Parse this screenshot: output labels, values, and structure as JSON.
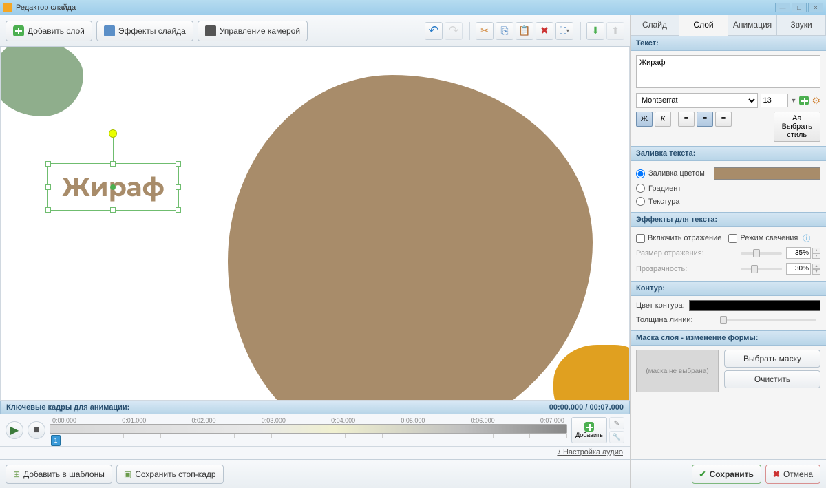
{
  "window": {
    "title": "Редактор слайда"
  },
  "toolbar": {
    "add_layer": "Добавить слой",
    "slide_effects": "Эффекты слайда",
    "camera_control": "Управление камерой"
  },
  "canvas": {
    "text_object": "Жираф"
  },
  "timeline": {
    "header": "Ключевые кадры для анимации:",
    "time_display": "00:00.000 / 00:07.000",
    "marks": [
      "0:00.000",
      "0:01.000",
      "0:02.000",
      "0:03.000",
      "0:04.000",
      "0:05.000",
      "0:06.000",
      "0:07.000"
    ],
    "keyframe_num": "1",
    "add_btn": "Добавить",
    "audio_link": "Настройка аудио"
  },
  "bottom": {
    "add_templates": "Добавить в шаблоны",
    "save_frame": "Сохранить стоп-кадр",
    "save": "Сохранить",
    "cancel": "Отмена"
  },
  "tabs": {
    "slide": "Слайд",
    "layer": "Слой",
    "animation": "Анимация",
    "sounds": "Звуки"
  },
  "panel": {
    "text_section": "Текст:",
    "text_value": "Жираф",
    "font": "Montserrat",
    "font_size": "13",
    "bold": "Ж",
    "italic": "К",
    "choose_style": "Выбрать стиль",
    "fill_section": "Заливка текста:",
    "fill_color": "Заливка цветом",
    "gradient": "Градиент",
    "texture": "Текстура",
    "effects_section": "Эффекты для текста:",
    "reflection": "Включить отражение",
    "glow": "Режим свечения",
    "refl_size": "Размер отражения:",
    "refl_size_val": "35%",
    "transparency": "Прозрачность:",
    "transparency_val": "30%",
    "contour_section": "Контур:",
    "contour_color": "Цвет контура:",
    "line_width": "Толщина линии:",
    "mask_section": "Маска слоя - изменение формы:",
    "mask_none": "(маска не выбрана)",
    "choose_mask": "Выбрать маску",
    "clear_mask": "Очистить"
  }
}
